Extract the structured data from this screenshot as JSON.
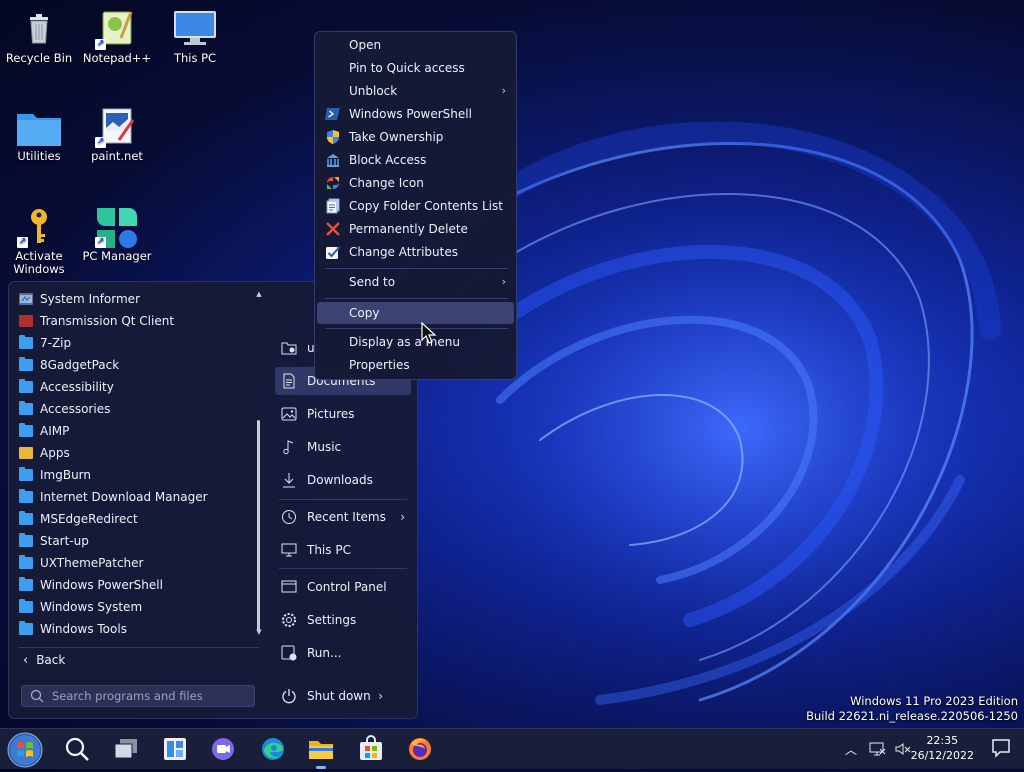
{
  "desktop": {
    "icons": [
      {
        "label": "Recycle Bin",
        "icon": "recycle-bin-icon"
      },
      {
        "label": "Notepad++",
        "icon": "notepad-plus-plus-icon"
      },
      {
        "label": "This PC",
        "icon": "this-pc-icon"
      },
      {
        "label": "Utilities",
        "icon": "folder-icon"
      },
      {
        "label": "paint.net",
        "icon": "paintnet-icon"
      },
      {
        "label": "Activate Windows",
        "icon": "key-icon"
      },
      {
        "label": "PC Manager",
        "icon": "pc-manager-icon"
      }
    ]
  },
  "start_menu": {
    "programs": [
      "System Informer",
      "Transmission Qt Client",
      "7-Zip",
      "8GadgetPack",
      "Accessibility",
      "Accessories",
      "AIMP",
      "Apps",
      "ImgBurn",
      "Internet Download Manager",
      "MSEdgeRedirect",
      "Start-up",
      "UXThemePatcher",
      "Windows PowerShell",
      "Windows System",
      "Windows Tools"
    ],
    "back_label": "Back",
    "search_placeholder": "Search programs and files",
    "right_items": [
      {
        "label": "us",
        "icon": "user-folder-icon"
      },
      {
        "label": "Documents",
        "icon": "document-icon"
      },
      {
        "label": "Pictures",
        "icon": "picture-icon"
      },
      {
        "label": "Music",
        "icon": "music-icon"
      },
      {
        "label": "Downloads",
        "icon": "download-icon"
      },
      {
        "label": "Recent Items",
        "icon": "clock-icon"
      },
      {
        "label": "This PC",
        "icon": "monitor-icon"
      },
      {
        "label": "Control Panel",
        "icon": "control-panel-icon"
      },
      {
        "label": "Settings",
        "icon": "gear-icon"
      },
      {
        "label": "Run...",
        "icon": "run-icon"
      }
    ],
    "shutdown_label": "Shut down"
  },
  "context_menu": {
    "items": [
      {
        "label": "Open"
      },
      {
        "label": "Pin to Quick access"
      },
      {
        "label": "Unblock"
      },
      {
        "label": "Windows PowerShell"
      },
      {
        "label": "Take Ownership"
      },
      {
        "label": "Block Access"
      },
      {
        "label": "Change Icon"
      },
      {
        "label": "Copy Folder Contents List"
      },
      {
        "label": "Permanently Delete"
      },
      {
        "label": "Change Attributes"
      },
      {
        "label": "Send to"
      },
      {
        "label": "Copy"
      },
      {
        "label": "Display as a menu"
      },
      {
        "label": "Properties"
      }
    ]
  },
  "watermark": {
    "line1": "Windows 11 Pro 2023 Edition",
    "line2": "Build 22621.ni_release.220506-1250"
  },
  "taskbar": {
    "time": "22:35",
    "date": "26/12/2022"
  }
}
